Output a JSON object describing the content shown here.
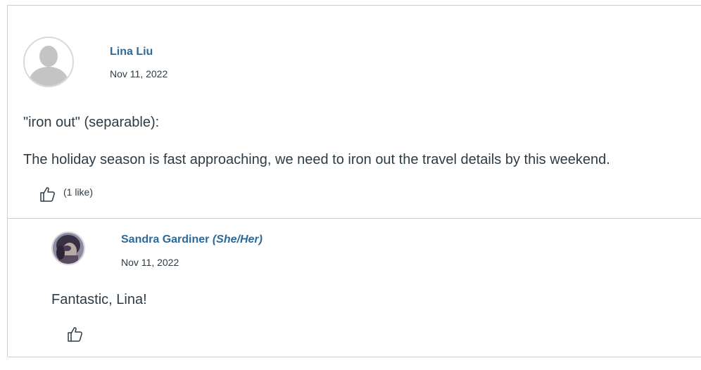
{
  "entries": [
    {
      "author": "Lina Liu",
      "date": "Nov 11, 2022",
      "body_line1": "\"iron out\" (separable):",
      "body_line2": "The holiday season is fast approaching, we need to iron out the travel details by this weekend.",
      "like_count_text": "(1 like)",
      "avatar_icon": "default-user-avatar-icon",
      "like_icon": "thumbs-up-icon"
    },
    {
      "author": "Sandra Gardiner",
      "pronouns": "(She/Her)",
      "date": "Nov 11, 2022",
      "body": "Fantastic, Lina!",
      "avatar_icon": "user-photo-avatar",
      "like_icon": "thumbs-up-icon"
    }
  ],
  "colors": {
    "link": "#2b6a9a",
    "text": "#2d3b45",
    "border": "#c7cdd1"
  }
}
